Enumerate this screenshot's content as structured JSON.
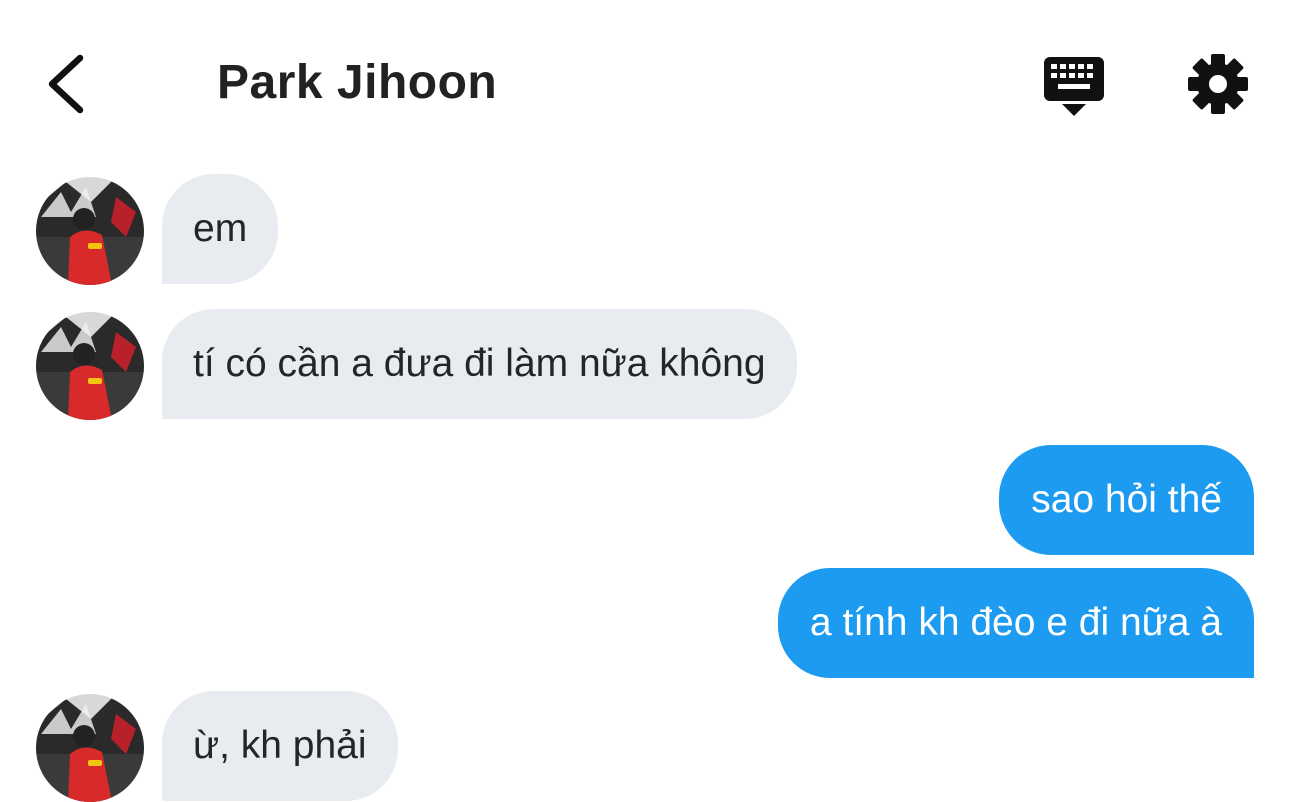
{
  "header": {
    "title": "Park Jihoon",
    "back_icon": "chevron-left-icon",
    "keyboard_icon": "keyboard-hide-icon",
    "settings_icon": "gear-icon"
  },
  "colors": {
    "incoming_bubble": "#e8ecf0",
    "outgoing_bubble": "#1d9bf0",
    "background": "#ffffff"
  },
  "messages": [
    {
      "direction": "incoming",
      "text": "em"
    },
    {
      "direction": "incoming",
      "text": "tí có cần a đưa đi làm nữa không"
    },
    {
      "direction": "outgoing",
      "text": "sao hỏi thế"
    },
    {
      "direction": "outgoing",
      "text": "a tính kh đèo e đi nữa à"
    },
    {
      "direction": "incoming",
      "text": "ừ, kh phải "
    }
  ]
}
